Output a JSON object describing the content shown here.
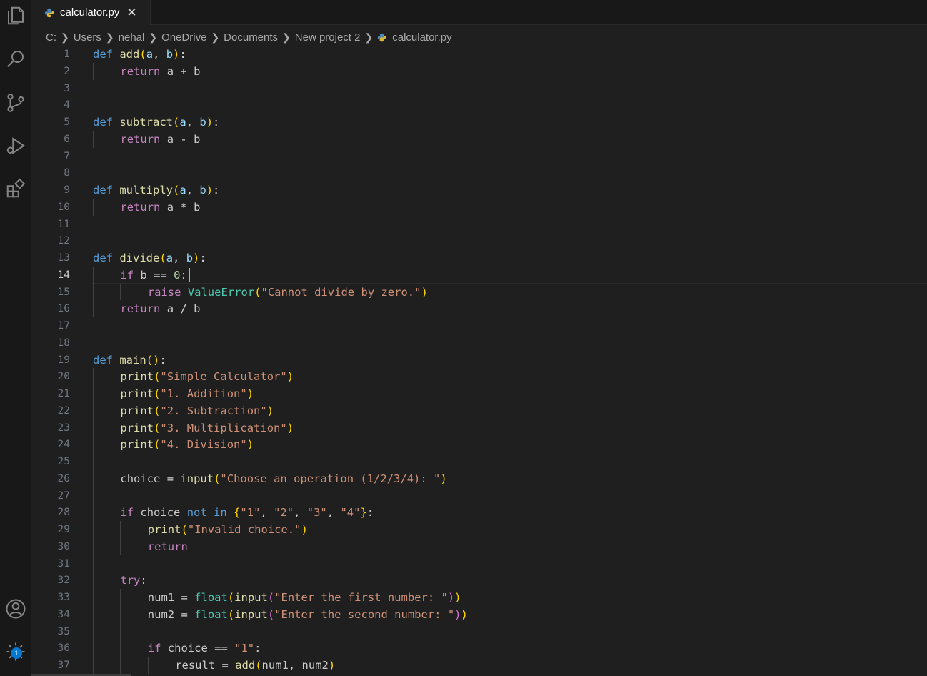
{
  "tab": {
    "label": "calculator.py",
    "close": "✕"
  },
  "breadcrumb": [
    "C:",
    "Users",
    "nehal",
    "OneDrive",
    "Documents",
    "New project 2",
    "calculator.py"
  ],
  "activity_bar": {
    "settings_badge": "1"
  },
  "editor": {
    "active_line": 14,
    "lines": [
      {
        "n": "1",
        "i": 0,
        "t": [
          [
            "kw",
            "def"
          ],
          [
            "",
            " "
          ],
          [
            "fn",
            "add"
          ],
          [
            "p1",
            "("
          ],
          [
            "param",
            "a"
          ],
          [
            "",
            ", "
          ],
          [
            "param",
            "b"
          ],
          [
            "p1",
            ")"
          ],
          [
            "",
            ":"
          ]
        ]
      },
      {
        "n": "2",
        "i": 1,
        "t": [
          [
            "ctl",
            "return"
          ],
          [
            "",
            " a "
          ],
          [
            "op",
            "+"
          ],
          [
            "",
            " b"
          ]
        ]
      },
      {
        "n": "3",
        "i": 0,
        "t": []
      },
      {
        "n": "4",
        "i": 0,
        "t": []
      },
      {
        "n": "5",
        "i": 0,
        "t": [
          [
            "kw",
            "def"
          ],
          [
            "",
            " "
          ],
          [
            "fn",
            "subtract"
          ],
          [
            "p1",
            "("
          ],
          [
            "param",
            "a"
          ],
          [
            "",
            ", "
          ],
          [
            "param",
            "b"
          ],
          [
            "p1",
            ")"
          ],
          [
            "",
            ":"
          ]
        ]
      },
      {
        "n": "6",
        "i": 1,
        "t": [
          [
            "ctl",
            "return"
          ],
          [
            "",
            " a "
          ],
          [
            "op",
            "-"
          ],
          [
            "",
            " b"
          ]
        ]
      },
      {
        "n": "7",
        "i": 0,
        "t": []
      },
      {
        "n": "8",
        "i": 0,
        "t": []
      },
      {
        "n": "9",
        "i": 0,
        "t": [
          [
            "kw",
            "def"
          ],
          [
            "",
            " "
          ],
          [
            "fn",
            "multiply"
          ],
          [
            "p1",
            "("
          ],
          [
            "param",
            "a"
          ],
          [
            "",
            ", "
          ],
          [
            "param",
            "b"
          ],
          [
            "p1",
            ")"
          ],
          [
            "",
            ":"
          ]
        ]
      },
      {
        "n": "10",
        "i": 1,
        "t": [
          [
            "ctl",
            "return"
          ],
          [
            "",
            " a "
          ],
          [
            "op",
            "*"
          ],
          [
            "",
            " b"
          ]
        ]
      },
      {
        "n": "11",
        "i": 0,
        "t": []
      },
      {
        "n": "12",
        "i": 0,
        "t": []
      },
      {
        "n": "13",
        "i": 0,
        "t": [
          [
            "kw",
            "def"
          ],
          [
            "",
            " "
          ],
          [
            "fn",
            "divide"
          ],
          [
            "p1",
            "("
          ],
          [
            "param",
            "a"
          ],
          [
            "",
            ", "
          ],
          [
            "param",
            "b"
          ],
          [
            "p1",
            ")"
          ],
          [
            "",
            ":"
          ]
        ]
      },
      {
        "n": "14",
        "i": 1,
        "t": [
          [
            "ctl",
            "if"
          ],
          [
            "",
            " b "
          ],
          [
            "op",
            "=="
          ],
          [
            "",
            " "
          ],
          [
            "num",
            "0"
          ],
          [
            "",
            ":"
          ]
        ]
      },
      {
        "n": "15",
        "i": 2,
        "t": [
          [
            "ctl",
            "raise"
          ],
          [
            "",
            " "
          ],
          [
            "cls",
            "ValueError"
          ],
          [
            "p1",
            "("
          ],
          [
            "str",
            "\"Cannot divide by zero.\""
          ],
          [
            "p1",
            ")"
          ]
        ]
      },
      {
        "n": "16",
        "i": 1,
        "t": [
          [
            "ctl",
            "return"
          ],
          [
            "",
            " a "
          ],
          [
            "op",
            "/"
          ],
          [
            "",
            " b"
          ]
        ]
      },
      {
        "n": "17",
        "i": 0,
        "t": []
      },
      {
        "n": "18",
        "i": 0,
        "t": []
      },
      {
        "n": "19",
        "i": 0,
        "t": [
          [
            "kw",
            "def"
          ],
          [
            "",
            " "
          ],
          [
            "fn",
            "main"
          ],
          [
            "p1",
            "()"
          ],
          [
            "",
            ":"
          ]
        ]
      },
      {
        "n": "20",
        "i": 1,
        "t": [
          [
            "fn",
            "print"
          ],
          [
            "p1",
            "("
          ],
          [
            "str",
            "\"Simple Calculator\""
          ],
          [
            "p1",
            ")"
          ]
        ]
      },
      {
        "n": "21",
        "i": 1,
        "t": [
          [
            "fn",
            "print"
          ],
          [
            "p1",
            "("
          ],
          [
            "str",
            "\"1. Addition\""
          ],
          [
            "p1",
            ")"
          ]
        ]
      },
      {
        "n": "22",
        "i": 1,
        "t": [
          [
            "fn",
            "print"
          ],
          [
            "p1",
            "("
          ],
          [
            "str",
            "\"2. Subtraction\""
          ],
          [
            "p1",
            ")"
          ]
        ]
      },
      {
        "n": "23",
        "i": 1,
        "t": [
          [
            "fn",
            "print"
          ],
          [
            "p1",
            "("
          ],
          [
            "str",
            "\"3. Multiplication\""
          ],
          [
            "p1",
            ")"
          ]
        ]
      },
      {
        "n": "24",
        "i": 1,
        "t": [
          [
            "fn",
            "print"
          ],
          [
            "p1",
            "("
          ],
          [
            "str",
            "\"4. Division\""
          ],
          [
            "p1",
            ")"
          ]
        ]
      },
      {
        "n": "25",
        "i": 0,
        "t": []
      },
      {
        "n": "26",
        "i": 1,
        "t": [
          [
            "",
            "choice "
          ],
          [
            "op",
            "="
          ],
          [
            "",
            " "
          ],
          [
            "fn",
            "input"
          ],
          [
            "p1",
            "("
          ],
          [
            "str",
            "\"Choose an operation (1/2/3/4): \""
          ],
          [
            "p1",
            ")"
          ]
        ]
      },
      {
        "n": "27",
        "i": 0,
        "t": []
      },
      {
        "n": "28",
        "i": 1,
        "t": [
          [
            "ctl",
            "if"
          ],
          [
            "",
            " choice "
          ],
          [
            "kw",
            "not"
          ],
          [
            "",
            " "
          ],
          [
            "kw",
            "in"
          ],
          [
            "",
            " "
          ],
          [
            "p1",
            "{"
          ],
          [
            "str",
            "\"1\""
          ],
          [
            "",
            ", "
          ],
          [
            "str",
            "\"2\""
          ],
          [
            "",
            ", "
          ],
          [
            "str",
            "\"3\""
          ],
          [
            "",
            ", "
          ],
          [
            "str",
            "\"4\""
          ],
          [
            "p1",
            "}"
          ],
          [
            "",
            ":"
          ]
        ]
      },
      {
        "n": "29",
        "i": 2,
        "t": [
          [
            "fn",
            "print"
          ],
          [
            "p1",
            "("
          ],
          [
            "str",
            "\"Invalid choice.\""
          ],
          [
            "p1",
            ")"
          ]
        ]
      },
      {
        "n": "30",
        "i": 2,
        "t": [
          [
            "ctl",
            "return"
          ]
        ]
      },
      {
        "n": "31",
        "i": 0,
        "t": []
      },
      {
        "n": "32",
        "i": 1,
        "t": [
          [
            "ctl",
            "try"
          ],
          [
            "",
            ":"
          ]
        ]
      },
      {
        "n": "33",
        "i": 2,
        "t": [
          [
            "",
            "num1 "
          ],
          [
            "op",
            "="
          ],
          [
            "",
            " "
          ],
          [
            "cls",
            "float"
          ],
          [
            "p1",
            "("
          ],
          [
            "fn",
            "input"
          ],
          [
            "p2",
            "("
          ],
          [
            "str",
            "\"Enter the first number: \""
          ],
          [
            "p2",
            ")"
          ],
          [
            "p1",
            ")"
          ]
        ]
      },
      {
        "n": "34",
        "i": 2,
        "t": [
          [
            "",
            "num2 "
          ],
          [
            "op",
            "="
          ],
          [
            "",
            " "
          ],
          [
            "cls",
            "float"
          ],
          [
            "p1",
            "("
          ],
          [
            "fn",
            "input"
          ],
          [
            "p2",
            "("
          ],
          [
            "str",
            "\"Enter the second number: \""
          ],
          [
            "p2",
            ")"
          ],
          [
            "p1",
            ")"
          ]
        ]
      },
      {
        "n": "35",
        "i": 0,
        "t": []
      },
      {
        "n": "36",
        "i": 2,
        "t": [
          [
            "ctl",
            "if"
          ],
          [
            "",
            " choice "
          ],
          [
            "op",
            "=="
          ],
          [
            "",
            " "
          ],
          [
            "str",
            "\"1\""
          ],
          [
            "",
            ":"
          ]
        ]
      },
      {
        "n": "37",
        "i": 3,
        "t": [
          [
            "",
            "result "
          ],
          [
            "op",
            "="
          ],
          [
            "",
            " "
          ],
          [
            "fn",
            "add"
          ],
          [
            "p1",
            "("
          ],
          [
            "",
            "num1, num2"
          ],
          [
            "p1",
            ")"
          ]
        ]
      }
    ]
  }
}
